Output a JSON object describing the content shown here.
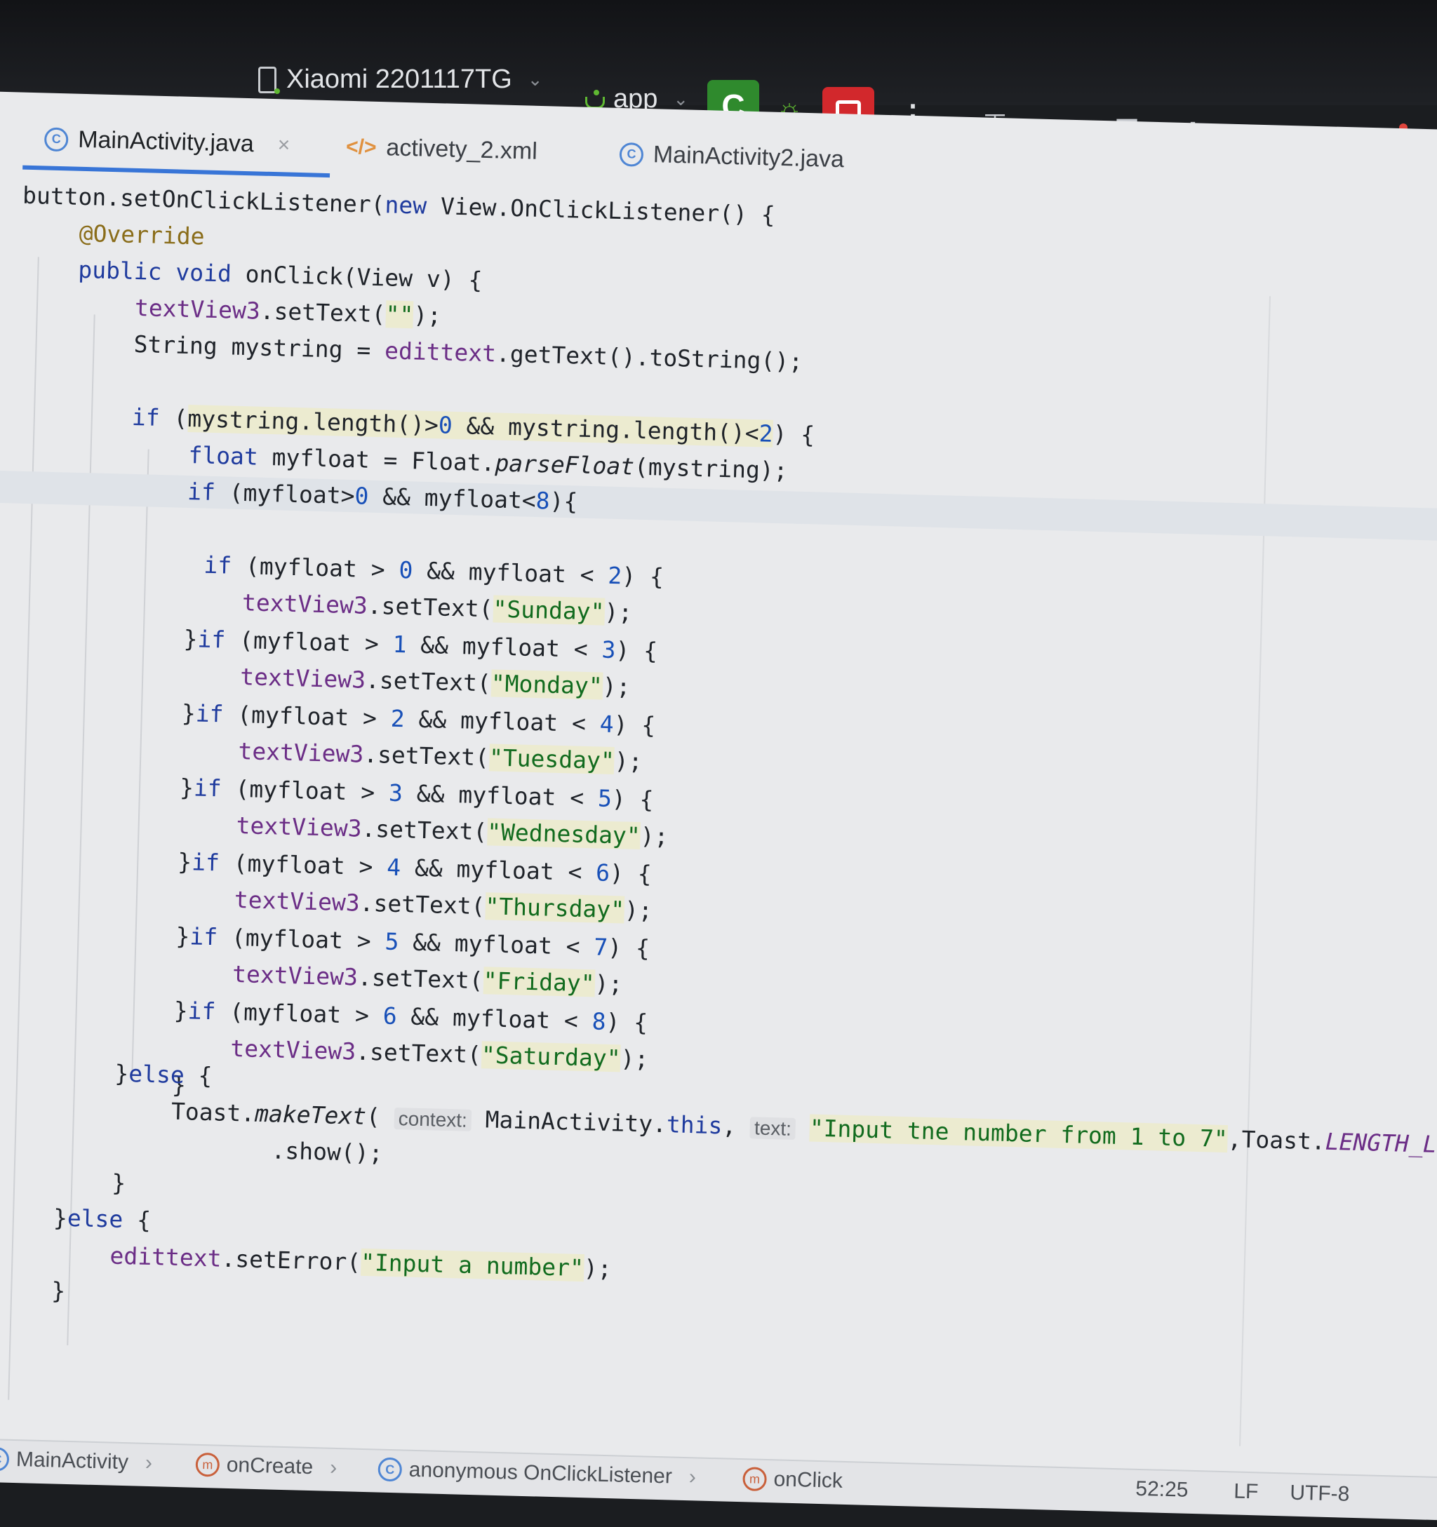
{
  "toolbar": {
    "device": "Xiaomi 2201117TG",
    "run_config": "app",
    "run_glyph": "C",
    "debug_glyph": "☼",
    "more_glyph": "⋮",
    "icons": [
      "layout-inspector-icon",
      "translate-icon",
      "profiler-icon",
      "debug-attach-icon",
      "device-mirror-icon",
      "search-icon",
      "settings-icon"
    ],
    "colors": {
      "run": "#2f8a2d",
      "stop": "#d2282c",
      "accent": "#3875d7"
    }
  },
  "tabs": [
    {
      "label": "MainActivity.java",
      "icon": "class-icon",
      "active": true
    },
    {
      "label": "activety_2.xml",
      "icon": "xml-icon",
      "active": false
    },
    {
      "label": "MainActivity2.java",
      "icon": "class-icon",
      "active": false
    }
  ],
  "tab_icons": {
    "class_letter": "C",
    "xml_glyph": "</>",
    "close_glyph": "×"
  },
  "code": {
    "l01": {
      "a": "button.setOnClickListener(",
      "b": "new",
      "c": " View.OnClickListener() {"
    },
    "l02": {
      "a": "@Override"
    },
    "l03": {
      "a": "public void",
      "b": " onClick(View v) {"
    },
    "l04": {
      "a": "textView3",
      "b": ".setText(",
      "c": "\"\"",
      "d": ");"
    },
    "l05": {
      "a": "String mystring = ",
      "b": "edittext",
      "c": ".getText().toString();"
    },
    "l07": {
      "a": "if",
      "b": " (",
      "c": "mystring.length()>",
      "d": "0",
      "e": " && mystring.length()<",
      "f": "2",
      "g": ") {"
    },
    "l08": {
      "a": "float",
      "b": " myfloat = Float.",
      "c": "parseFloat",
      "d": "(mystring);"
    },
    "l09": {
      "a": "if",
      "b": " (myfloat>",
      "c": "0",
      "d": " && myfloat<",
      "e": "8",
      "f": "){"
    },
    "days": [
      {
        "pre": "if",
        "lo": "0",
        "hi": "2",
        "day": "\"Sunday\"",
        "brace": ""
      },
      {
        "pre": "if",
        "lo": "1",
        "hi": "3",
        "day": "\"Monday\"",
        "brace": "}"
      },
      {
        "pre": "if",
        "lo": "2",
        "hi": "4",
        "day": "\"Tuesday\"",
        "brace": "}"
      },
      {
        "pre": "if",
        "lo": "3",
        "hi": "5",
        "day": "\"Wednesday\"",
        "brace": "}"
      },
      {
        "pre": "if",
        "lo": "4",
        "hi": "6",
        "day": "\"Thursday\"",
        "brace": "}"
      },
      {
        "pre": "if",
        "lo": "5",
        "hi": "7",
        "day": "\"Friday\"",
        "brace": "}"
      },
      {
        "pre": "if",
        "lo": "6",
        "hi": "8",
        "day": "\"Saturday\"",
        "brace": "}"
      }
    ],
    "cond_mid": " (myfloat > ",
    "cond_and": " && myfloat < ",
    "cond_end": ") {",
    "set_prefix": "textView3",
    "set_call": ".setText(",
    "set_end": ");",
    "close_brace": "}",
    "else_brace": "}",
    "else_kw": "else",
    "else_open": " {",
    "toast": {
      "a": "Toast.",
      "b": "makeText",
      "c": "( ",
      "hint1": "context:",
      "d": " MainActivity.",
      "e": "this",
      "f": ", ",
      "hint2": "text:",
      "g": " ",
      "msg": "\"Input tne number from 1 to 7\"",
      "h": ",Toast.",
      "len": "LENGTH_L"
    },
    "show": ".show();",
    "seterror": {
      "a": "edittext",
      "b": ".setError(",
      "c": "\"Input a number\"",
      "d": ");"
    }
  },
  "breadcrumbs": [
    {
      "label": "MainActivity",
      "icon": "class-icon"
    },
    {
      "label": "onCreate",
      "icon": "method-icon"
    },
    {
      "label": "anonymous OnClickListener",
      "icon": "class-icon"
    },
    {
      "label": "onClick",
      "icon": "method-icon"
    }
  ],
  "crumb_sep": "›",
  "method_letter": "m",
  "status": {
    "position": "52:25",
    "line_ending": "LF",
    "encoding": "UTF-8"
  }
}
